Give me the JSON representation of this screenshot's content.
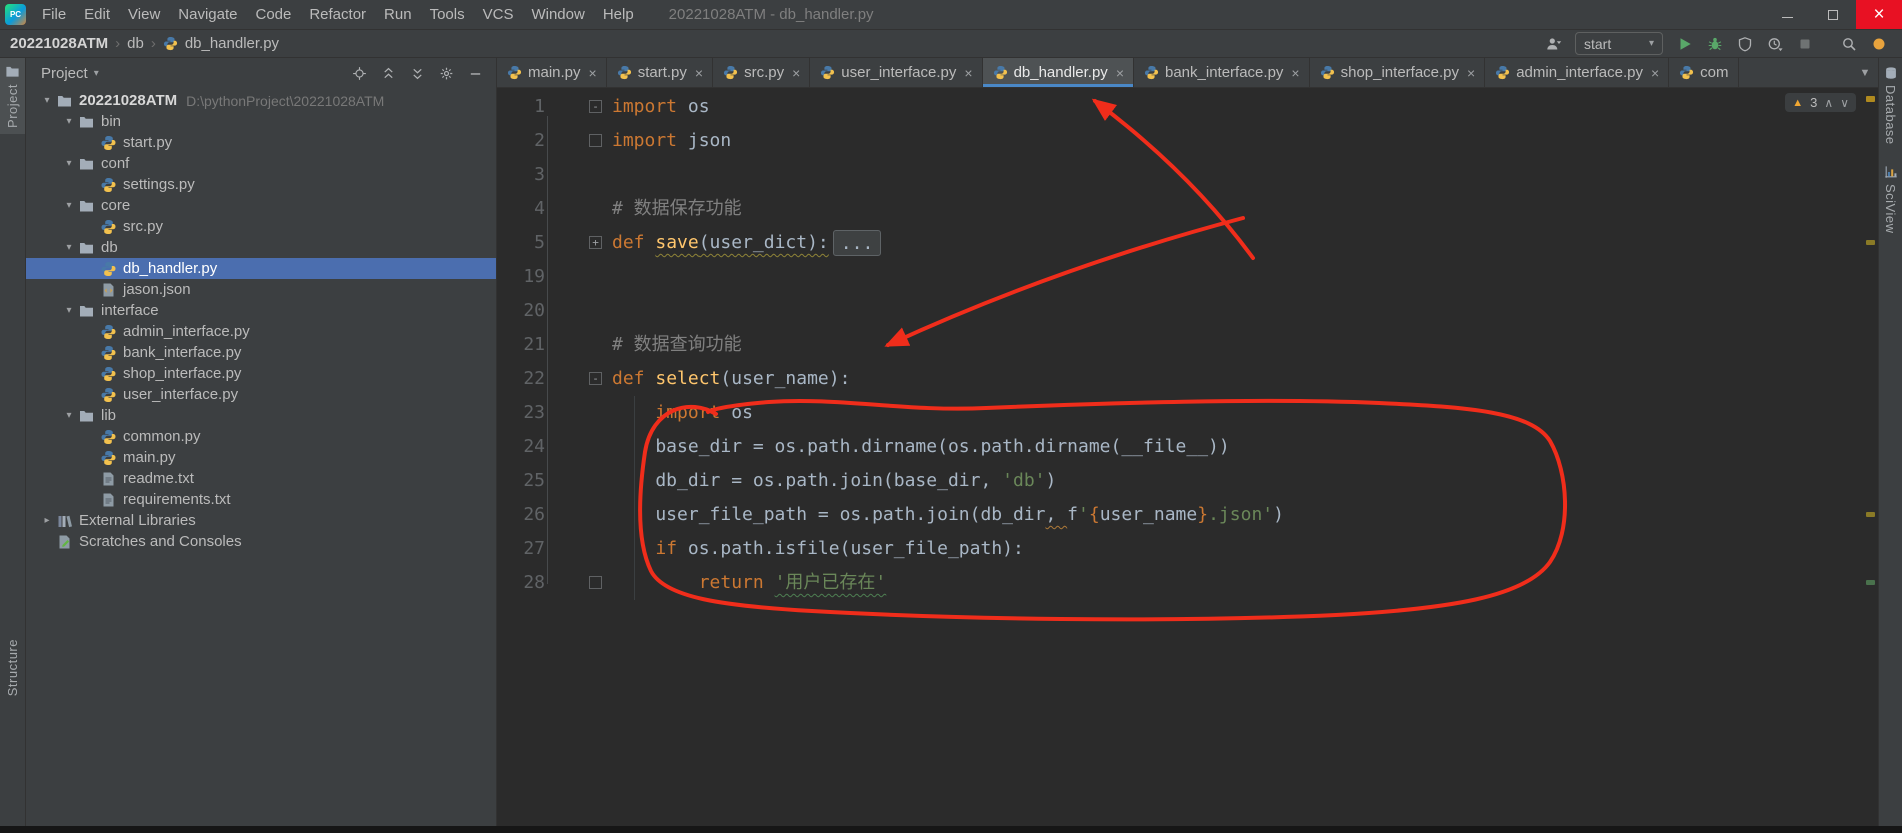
{
  "colors": {
    "annotation_red": "#F02D1B",
    "selection_blue": "#4B6EAF",
    "tab_underline_blue": "#4A88C7",
    "close_button_red": "#E81123",
    "keyword_orange": "#CC7832",
    "function_yellow": "#FFC66D",
    "plain_text": "#A9B7C6",
    "string_green": "#6A8759",
    "comment_gray": "#808080"
  },
  "window": {
    "title": "20221028ATM - db_handler.py",
    "menus": [
      "File",
      "Edit",
      "View",
      "Navigate",
      "Code",
      "Refactor",
      "Run",
      "Tools",
      "VCS",
      "Window",
      "Help"
    ],
    "controls": [
      "minimize",
      "maximize",
      "close"
    ]
  },
  "toolbar": {
    "breadcrumbs": [
      {
        "label": "20221028ATM",
        "bold": true
      },
      {
        "label": "db"
      },
      {
        "label": "db_handler.py",
        "icon": "python-file"
      }
    ],
    "run_config": "start",
    "right_icons": [
      "collaborate",
      "run",
      "debug",
      "coverage",
      "profile",
      "stop",
      "search",
      "notification"
    ]
  },
  "left_stripe": {
    "top": "Project",
    "bottom": "Structure"
  },
  "right_stripe": {
    "items": [
      {
        "label": "Database",
        "icon": "database"
      },
      {
        "label": "SciView",
        "icon": "sciview"
      }
    ]
  },
  "project_panel": {
    "title": "Project",
    "header_icons": [
      "locate",
      "collapse-all",
      "expand-all",
      "settings",
      "hide"
    ],
    "tree": [
      {
        "label": "20221028ATM",
        "path": "D:\\pythonProject\\20221028ATM",
        "icon": "folder",
        "depth": 0,
        "chevron": "down",
        "root": true
      },
      {
        "label": "bin",
        "icon": "folder",
        "depth": 1,
        "chevron": "down"
      },
      {
        "label": "start.py",
        "icon": "python-file",
        "depth": 2
      },
      {
        "label": "conf",
        "icon": "folder",
        "depth": 1,
        "chevron": "down"
      },
      {
        "label": "settings.py",
        "icon": "python-file",
        "depth": 2
      },
      {
        "label": "core",
        "icon": "folder",
        "depth": 1,
        "chevron": "down"
      },
      {
        "label": "src.py",
        "icon": "python-file",
        "depth": 2
      },
      {
        "label": "db",
        "icon": "folder",
        "depth": 1,
        "chevron": "down"
      },
      {
        "label": "db_handler.py",
        "icon": "python-file",
        "depth": 2,
        "selected": true
      },
      {
        "label": "jason.json",
        "icon": "json-file",
        "depth": 2
      },
      {
        "label": "interface",
        "icon": "folder",
        "depth": 1,
        "chevron": "down"
      },
      {
        "label": "admin_interface.py",
        "icon": "python-file",
        "depth": 2
      },
      {
        "label": "bank_interface.py",
        "icon": "python-file",
        "depth": 2
      },
      {
        "label": "shop_interface.py",
        "icon": "python-file",
        "depth": 2
      },
      {
        "label": "user_interface.py",
        "icon": "python-file",
        "depth": 2
      },
      {
        "label": "lib",
        "icon": "folder",
        "depth": 1,
        "chevron": "down"
      },
      {
        "label": "common.py",
        "icon": "python-file",
        "depth": 2
      },
      {
        "label": "main.py",
        "icon": "python-file",
        "depth": 2
      },
      {
        "label": "readme.txt",
        "icon": "text-file",
        "depth": 2
      },
      {
        "label": "requirements.txt",
        "icon": "text-file",
        "depth": 2
      },
      {
        "label": "External Libraries",
        "icon": "libraries",
        "depth": 0,
        "chevron": "right"
      },
      {
        "label": "Scratches and Consoles",
        "icon": "scratches",
        "depth": 0
      }
    ]
  },
  "tabs": [
    {
      "label": "main.py",
      "icon": "python-file"
    },
    {
      "label": "start.py",
      "icon": "python-file"
    },
    {
      "label": "src.py",
      "icon": "python-file"
    },
    {
      "label": "user_interface.py",
      "icon": "python-file"
    },
    {
      "label": "db_handler.py",
      "icon": "python-file",
      "active": true
    },
    {
      "label": "bank_interface.py",
      "icon": "python-file"
    },
    {
      "label": "shop_interface.py",
      "icon": "python-file"
    },
    {
      "label": "admin_interface.py",
      "icon": "python-file"
    },
    {
      "label": "com",
      "icon": "python-file",
      "truncated": true
    }
  ],
  "editor": {
    "warning_count": "3",
    "lines": [
      {
        "num": "1",
        "fold": "minus",
        "code": [
          [
            "kw",
            "import"
          ],
          [
            "pl",
            " os"
          ]
        ]
      },
      {
        "num": "2",
        "fold": "end",
        "code": [
          [
            "kw",
            "import"
          ],
          [
            "pl",
            " json"
          ]
        ]
      },
      {
        "num": "3",
        "code": []
      },
      {
        "num": "4",
        "code": [
          [
            "cm",
            "# 数据保存功能"
          ]
        ]
      },
      {
        "num": "5",
        "fold": "plus",
        "code": [
          [
            "kw",
            "def "
          ],
          [
            "fn wavy-y",
            "save"
          ],
          [
            "pl wavy-y",
            "(user_dict):"
          ],
          [
            "foldbox",
            "..."
          ]
        ]
      },
      {
        "num": "19",
        "code": []
      },
      {
        "num": "20",
        "code": []
      },
      {
        "num": "21",
        "code": [
          [
            "cm",
            "# 数据查询功能"
          ]
        ]
      },
      {
        "num": "22",
        "fold": "minus",
        "code": [
          [
            "kw",
            "def "
          ],
          [
            "fn",
            "select"
          ],
          [
            "pl",
            "(user_name):"
          ]
        ]
      },
      {
        "num": "23",
        "code": [
          [
            "pl",
            "    "
          ],
          [
            "kw",
            "import"
          ],
          [
            "pl",
            " os"
          ]
        ]
      },
      {
        "num": "24",
        "code": [
          [
            "pl",
            "    base_dir = os.path.dirname(os.path.dirname(__file__))"
          ]
        ]
      },
      {
        "num": "25",
        "code": [
          [
            "pl",
            "    db_dir = os.path.join(base_dir, "
          ],
          [
            "str",
            "'db'"
          ],
          [
            "pl",
            ")"
          ]
        ]
      },
      {
        "num": "26",
        "code": [
          [
            "pl",
            "    user_file_path = os.path.join(db_dir"
          ],
          [
            "pl wavy-o",
            ", "
          ],
          [
            "pl",
            "f"
          ],
          [
            "str",
            "'"
          ],
          [
            "kw",
            "{"
          ],
          [
            "pl",
            "user_name"
          ],
          [
            "kw",
            "}"
          ],
          [
            "str",
            ".json'"
          ],
          [
            "pl",
            ")"
          ]
        ]
      },
      {
        "num": "27",
        "code": [
          [
            "pl",
            "    "
          ],
          [
            "kw",
            "if"
          ],
          [
            "pl",
            " os.path.isfile(user_file_path):"
          ]
        ]
      },
      {
        "num": "28",
        "fold": "end",
        "code": [
          [
            "pl",
            "        "
          ],
          [
            "kw",
            "return"
          ],
          [
            "pl",
            " "
          ],
          [
            "str wavy-g",
            "'用户已存在'"
          ]
        ]
      }
    ]
  }
}
